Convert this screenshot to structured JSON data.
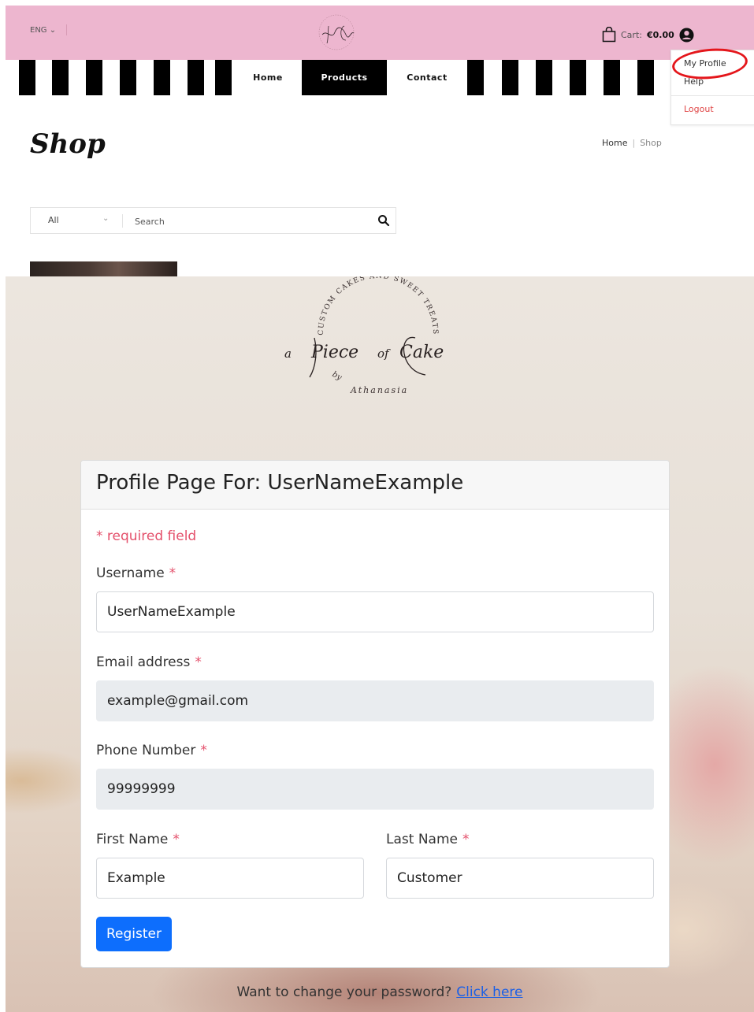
{
  "header": {
    "language": "ENG",
    "cart_label": "Cart:",
    "cart_amount": "€0.00",
    "brand_color": "#edb6cf"
  },
  "nav": {
    "items": [
      {
        "label": "Home",
        "active": false
      },
      {
        "label": "Products",
        "active": true
      },
      {
        "label": "Contact",
        "active": false
      }
    ]
  },
  "user_menu": {
    "items": [
      "My Profile",
      "Help"
    ],
    "logout": "Logout"
  },
  "shop": {
    "title": "Shop",
    "breadcrumb": [
      "Home",
      "Shop"
    ],
    "category": "All",
    "search_placeholder": "Search"
  },
  "logo": {
    "arc_top": "CUSTOM CAKES AND SWEET TREATS",
    "brand_a": "a",
    "brand_piece": "Piece",
    "brand_of": "of",
    "brand_cake": "Cake",
    "by": "by",
    "maker": "Athanasia"
  },
  "profile": {
    "title": "Profile Page For: UserNameExample",
    "required_note": "* required field",
    "fields": {
      "username": {
        "label": "Username",
        "value": "UserNameExample"
      },
      "email": {
        "label": "Email address",
        "value": "example@gmail.com"
      },
      "phone": {
        "label": "Phone Number",
        "value": "99999999"
      },
      "first_name": {
        "label": "First Name",
        "value": "Example"
      },
      "last_name": {
        "label": "Last Name",
        "value": "Customer"
      }
    },
    "required_marker": "*",
    "submit_label": "Register",
    "footer_text": "Want to change your password?",
    "footer_link": "Click here"
  }
}
